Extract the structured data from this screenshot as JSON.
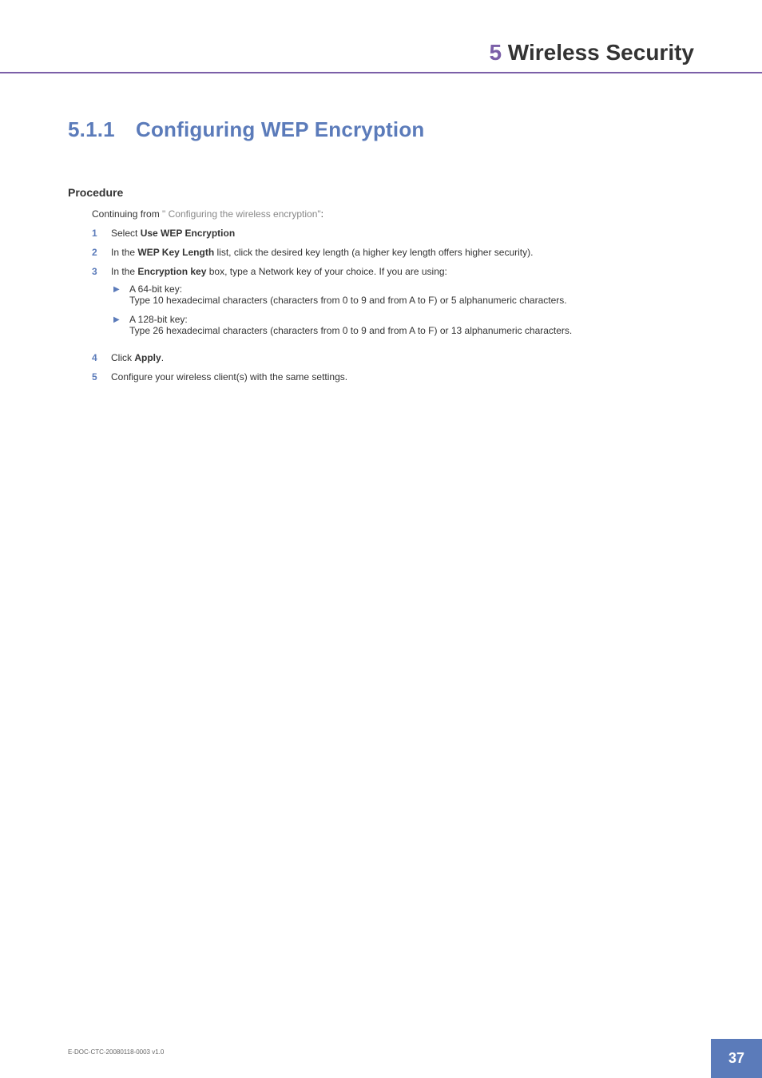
{
  "header": {
    "chapterNumber": "5",
    "chapterTitle": " Wireless Security"
  },
  "section": {
    "number": "5.1.1",
    "title": "Configuring WEP Encryption"
  },
  "procedure": {
    "heading": "Procedure",
    "intro": {
      "prefix": "Continuing from ",
      "link": "\" Configuring the wireless encryption\"",
      "suffix": ":"
    },
    "steps": [
      {
        "number": "1",
        "prefix": "Select ",
        "bold1": "Use WEP Encryption",
        "suffix": ""
      },
      {
        "number": "2",
        "prefix": "In the ",
        "bold1": "WEP Key Length",
        "suffix": " list, click the desired key length (a higher key length offers higher security)."
      },
      {
        "number": "3",
        "prefix": "In the ",
        "bold1": "Encryption key",
        "suffix": " box, type a Network key of your choice. If you are using:",
        "bullets": [
          {
            "title": "A 64-bit key:",
            "desc": "Type 10 hexadecimal characters (characters from 0 to 9 and from A to F) or 5 alphanumeric characters."
          },
          {
            "title": "A 128-bit key:",
            "desc": "Type 26 hexadecimal characters (characters from 0 to 9 and from A to F) or 13 alphanumeric characters."
          }
        ]
      },
      {
        "number": "4",
        "prefix": "Click ",
        "bold1": "Apply",
        "suffix": "."
      },
      {
        "number": "5",
        "prefix": "Configure your wireless client(s) with the same settings.",
        "bold1": "",
        "suffix": ""
      }
    ]
  },
  "footer": {
    "docId": "E-DOC-CTC-20080118-0003 v1.0",
    "pageNumber": "37"
  }
}
